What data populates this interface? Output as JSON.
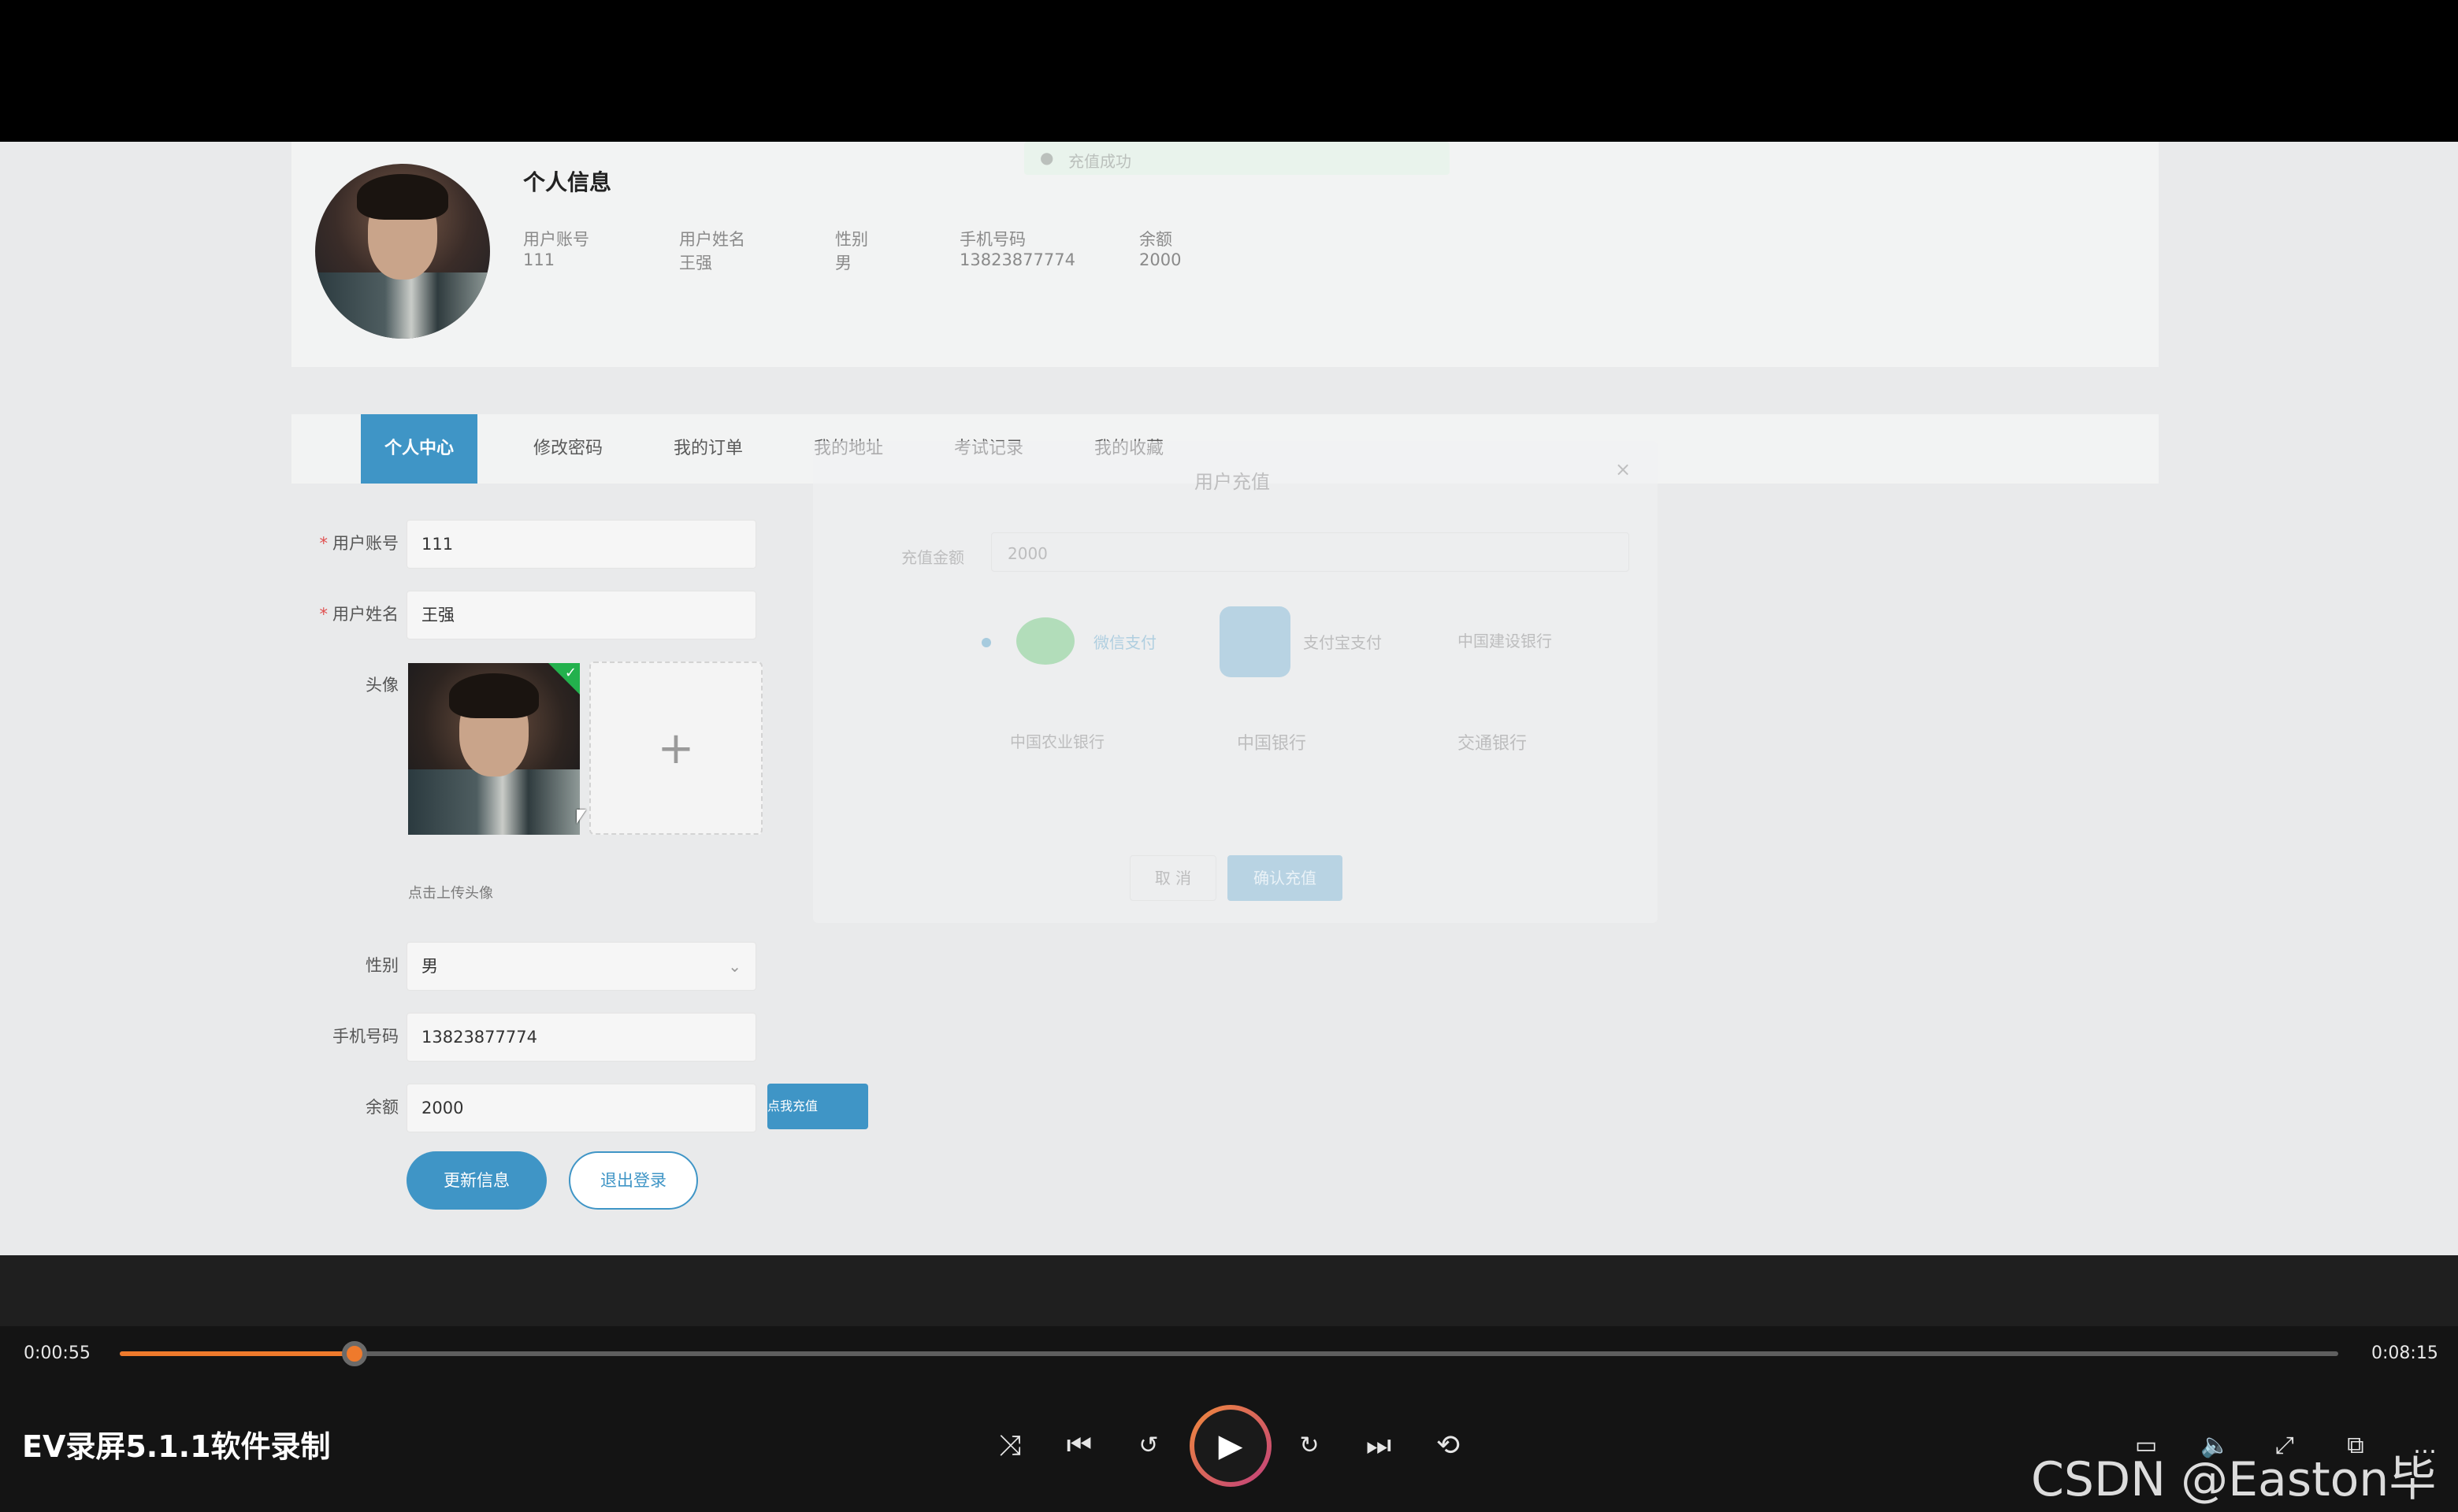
{
  "profile": {
    "title": "个人信息",
    "fields": [
      {
        "label": "用户账号",
        "value": "111"
      },
      {
        "label": "用户姓名",
        "value": "王强"
      },
      {
        "label": "性别",
        "value": "男"
      },
      {
        "label": "手机号码",
        "value": "13823877774"
      },
      {
        "label": "余额",
        "value": "2000"
      }
    ]
  },
  "toast": {
    "text": "充值成功"
  },
  "tabs": [
    "个人中心",
    "修改密码",
    "我的订单",
    "我的地址",
    "考试记录",
    "我的收藏"
  ],
  "form": {
    "account": {
      "label": "用户账号",
      "value": "111"
    },
    "name": {
      "label": "用户姓名",
      "value": "王强"
    },
    "avatar_label": "头像",
    "upload_hint": "点击上传头像",
    "gender": {
      "label": "性别",
      "value": "男"
    },
    "phone": {
      "label": "手机号码",
      "value": "13823877774"
    },
    "balance": {
      "label": "余额",
      "value": "2000"
    },
    "recharge_button": "点我充值",
    "update_button": "更新信息",
    "logout_button": "退出登录"
  },
  "modal": {
    "title": "用户充值",
    "amount_label": "充值金额",
    "amount_value": "2000",
    "wechat": "微信支付",
    "alipay": "支付宝支付",
    "ccb": "中国建设银行",
    "abc": "中国农业银行",
    "boc": "中国银行",
    "bocom": "交通银行",
    "cancel": "取 消",
    "confirm": "确认充值"
  },
  "player": {
    "current_time": "0:00:55",
    "total_time": "0:08:15",
    "progress": 0.106,
    "app_title": "EV录屏5.1.1软件录制",
    "watermark": "CSDN @Easton毕设"
  }
}
